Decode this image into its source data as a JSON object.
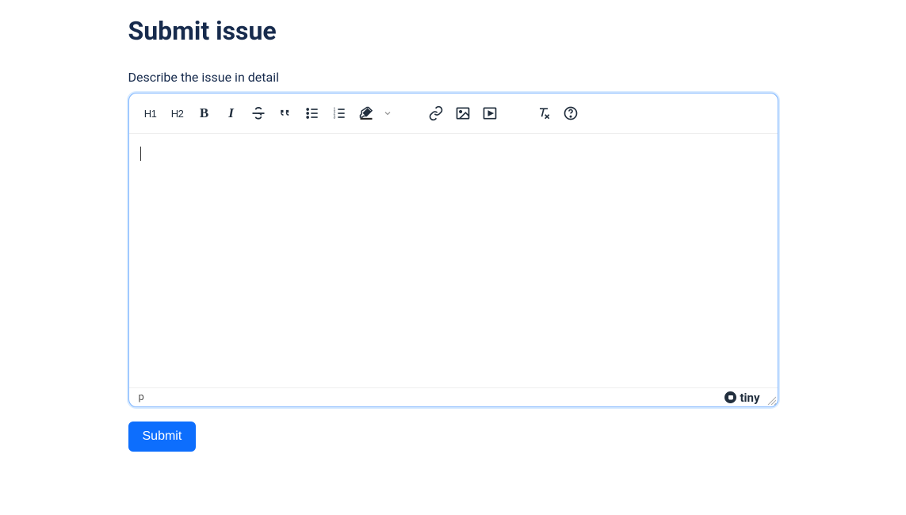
{
  "page": {
    "title": "Submit issue",
    "field_label": "Describe the issue in detail"
  },
  "toolbar": {
    "h1": "H1",
    "h2": "H2",
    "bold": "B",
    "italic": "I"
  },
  "statusbar": {
    "path": "p",
    "brand": "tiny"
  },
  "buttons": {
    "submit": "Submit"
  }
}
